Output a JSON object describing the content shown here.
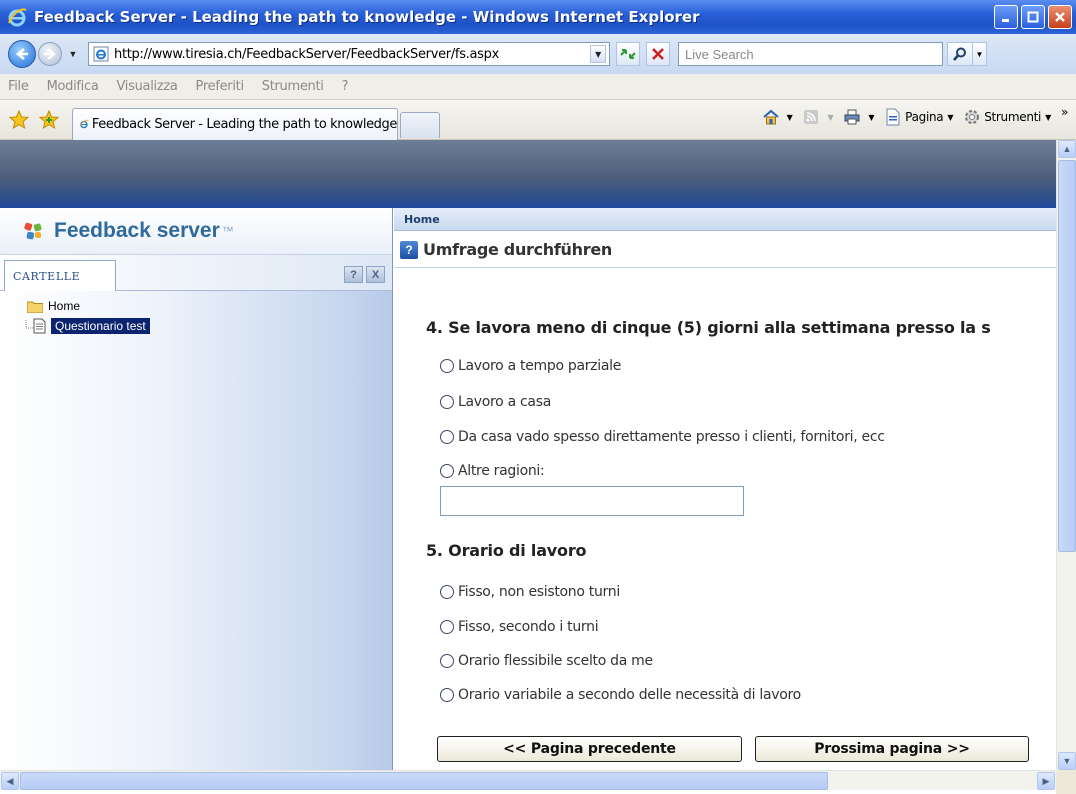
{
  "window": {
    "title": "Feedback Server - Leading the path to knowledge - Windows Internet Explorer"
  },
  "address_bar": {
    "url": "http://www.tiresia.ch/FeedbackServer/FeedbackServer/fs.aspx",
    "search_placeholder": "Live Search"
  },
  "menu": {
    "items": [
      "File",
      "Modifica",
      "Visualizza",
      "Preferiti",
      "Strumenti",
      "?"
    ]
  },
  "tabs": [
    {
      "label": "Feedback Server - Leading the path to knowledge"
    }
  ],
  "commands": {
    "page_label": "Pagina",
    "tools_label": "Strumenti",
    "overflow": "»"
  },
  "app": {
    "logo_text": "Feedback server",
    "logo_tm": "™",
    "breadcrumb": "Home",
    "panel_title": "Umfrage durchführen"
  },
  "sidebar": {
    "tab_label": "Cartelle",
    "help_btn": "?",
    "close_btn": "X",
    "tree": {
      "root": "Home",
      "children": [
        {
          "label": "Questionario test",
          "selected": true
        }
      ]
    }
  },
  "survey": {
    "questions": [
      {
        "title": "4. Se lavora meno di cinque (5) giorni alla settimana presso la s",
        "options": [
          "Lavoro a tempo parziale",
          "Lavoro a casa",
          "Da casa vado spesso direttamente presso i clienti, fornitori, ecc",
          "Altre ragioni:"
        ],
        "other_text_value": ""
      },
      {
        "title": "5. Orario di lavoro",
        "options": [
          "Fisso, non esistono turni",
          "Fisso, secondo i turni",
          "Orario flessibile scelto da me",
          "Orario variabile a secondo delle necessità di lavoro"
        ]
      }
    ],
    "prev_button": "<< Pagina precedente",
    "next_button": "Prossima pagina >>"
  },
  "colors": {
    "titlebar": "#2a60d8",
    "selection": "#0b2470",
    "logo": "#2e6a9e",
    "help_icon": "#1c4fa4"
  }
}
